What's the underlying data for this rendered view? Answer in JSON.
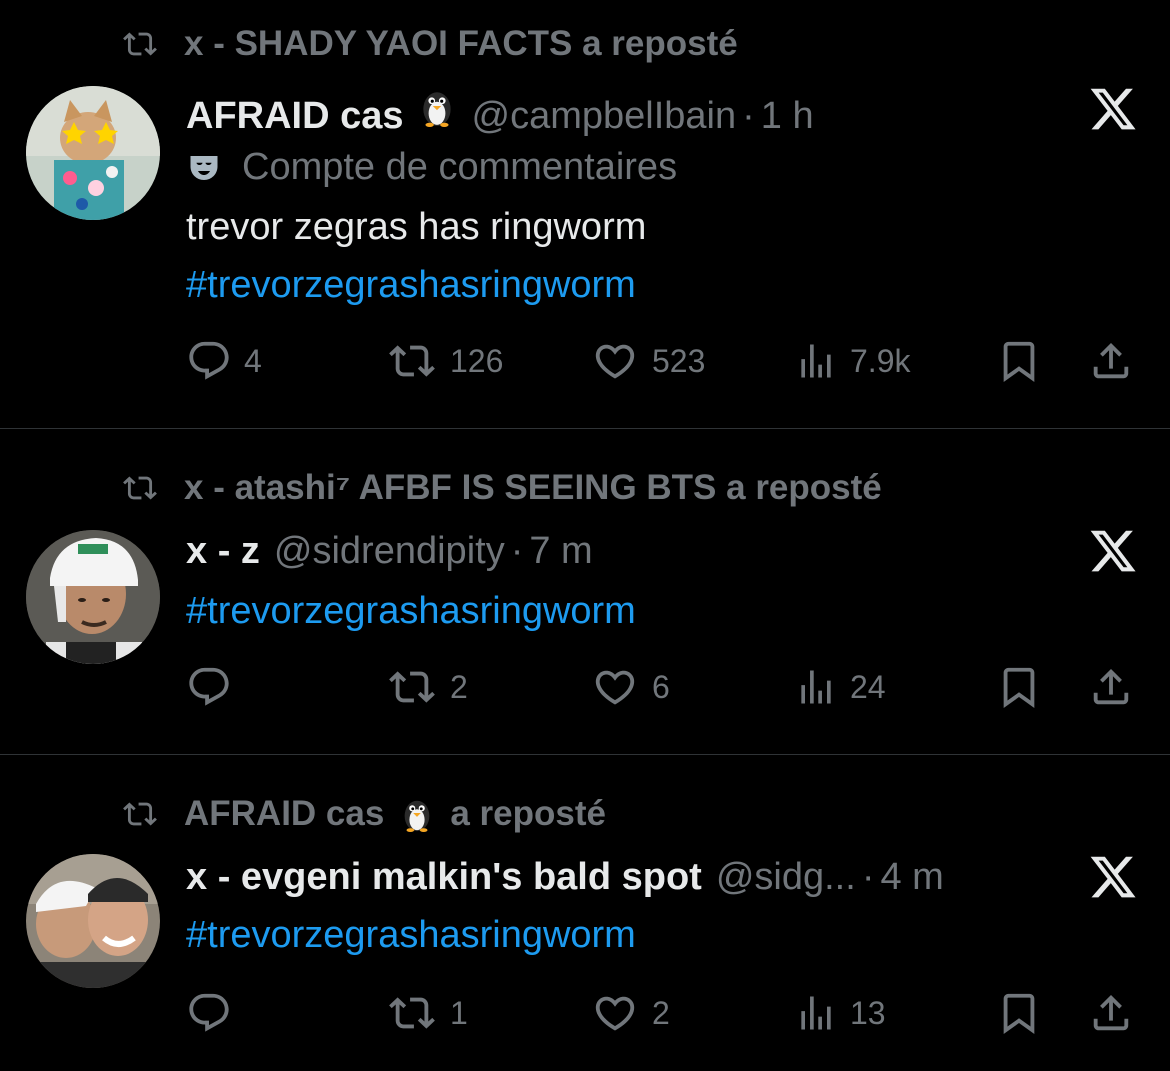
{
  "colors": {
    "background": "#000000",
    "text_primary": "#e7e9ea",
    "text_secondary": "#71767b",
    "hashtag": "#1d9bf0",
    "divider": "#2f3336"
  },
  "tweets": [
    {
      "repost_by": "x - SHADY YAOI FACTS a reposté",
      "display_name": "AFRAID cas",
      "name_emoji": "penguin-icon",
      "handle": "@campbelIbain",
      "dot": "·",
      "time": "1 h",
      "community_label": "Compte de commentaires",
      "text": "trevor zegras has ringworm",
      "hashtag": "#trevorzegrashasringworm",
      "replies": "4",
      "reposts": "126",
      "likes": "523",
      "views": "7.9k"
    },
    {
      "repost_by": "x - atashi⁷ AFBF IS SEEING BTS a reposté",
      "display_name": "x - z",
      "handle": "@sidrendipity",
      "dot": "·",
      "time": "7 m",
      "hashtag": "#trevorzegrashasringworm",
      "replies": "",
      "reposts": "2",
      "likes": "6",
      "views": "24"
    },
    {
      "repost_by_name": "AFRAID cas",
      "repost_by_suffix": "a reposté",
      "display_name": "x - evgeni malkin's bald spot",
      "handle": "@sidg...",
      "dot": "·",
      "time": "4 m",
      "hashtag": "#trevorzegrashasringworm",
      "replies": "",
      "reposts": "1",
      "likes": "2",
      "views": "13"
    }
  ]
}
